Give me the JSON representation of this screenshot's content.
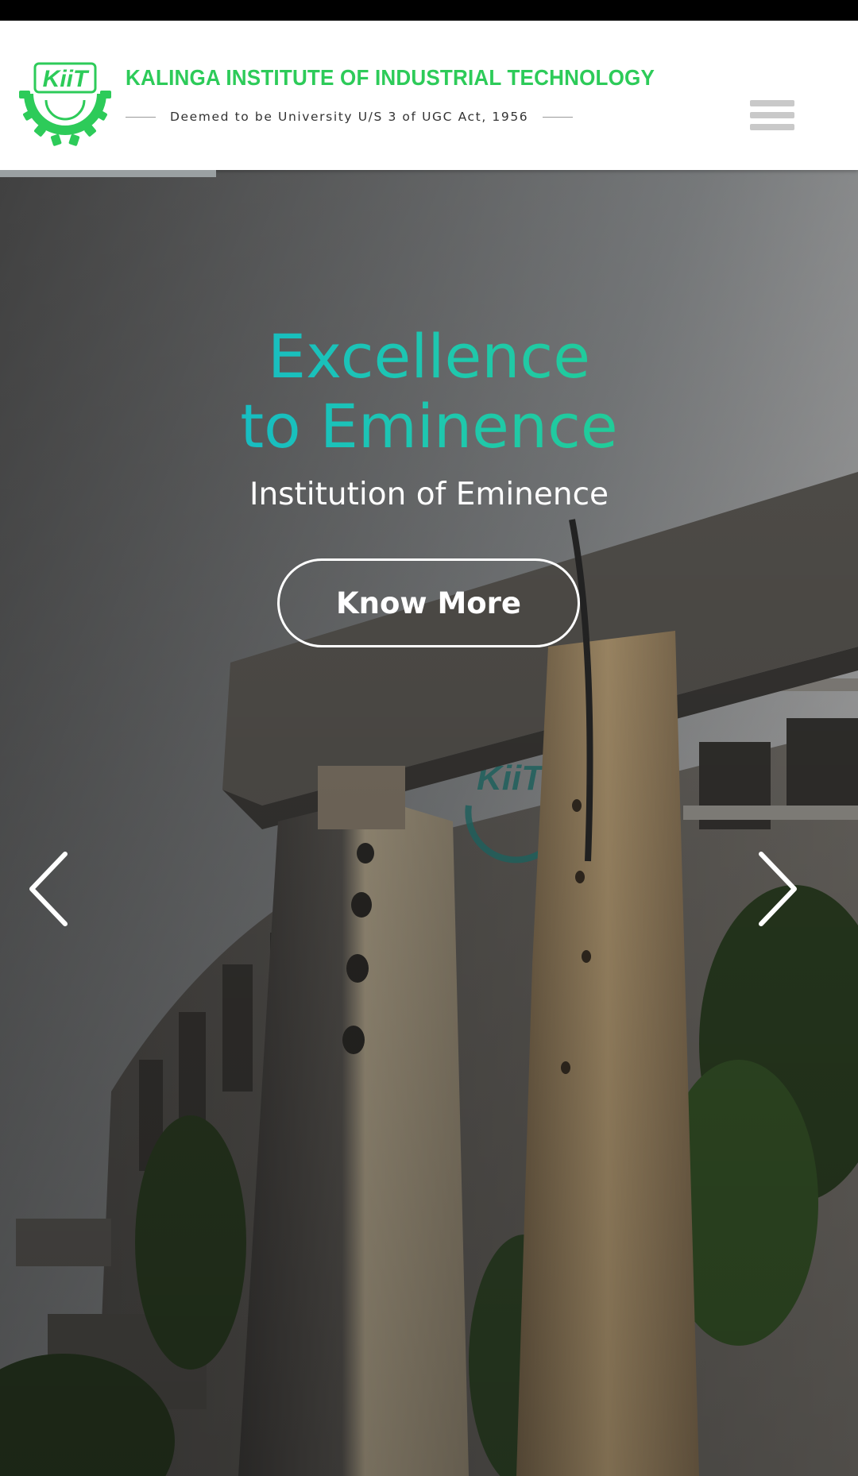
{
  "header": {
    "logo_text": "KiiT",
    "title": "KALINGA INSTITUTE OF INDUSTRIAL TECHNOLOGY",
    "subtitle": "Deemed to be University U/S 3 of UGC Act, 1956",
    "brand_color": "#2dcb59",
    "menu_icon": "hamburger-menu-icon"
  },
  "hero": {
    "headline_line1": "Excellence",
    "headline_line2": "to Eminence",
    "tagline": "Institution of Eminence",
    "cta_label": "Know More",
    "gradient_colors": [
      "#0fb0d8",
      "#25d27a"
    ],
    "prev_icon": "chevron-left-icon",
    "next_icon": "chevron-right-icon",
    "building_sign": "KiiT UNIVERSITY"
  }
}
